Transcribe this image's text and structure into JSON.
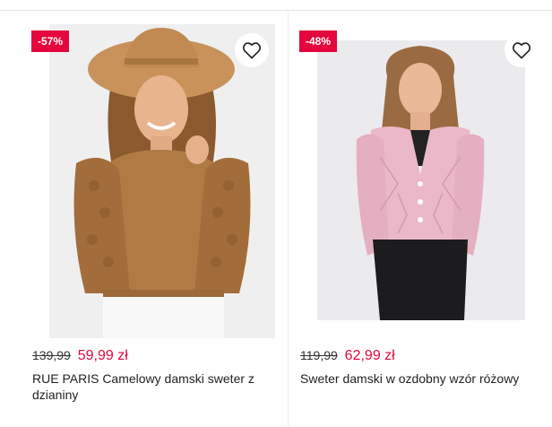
{
  "products": [
    {
      "badge": "-57%",
      "old_price": "139,99",
      "new_price": "59,99 zł",
      "title": "RUE PARIS Camelowy damski sweter z dzianiny",
      "image": "camel sweater model with hat"
    },
    {
      "badge": "-48%",
      "old_price": "119,99",
      "new_price": "62,99 zł",
      "title": "Sweter damski w ozdobny wzór różowy",
      "image": "pink cardigan model"
    }
  ],
  "colors": {
    "accent": "#e4063d"
  }
}
